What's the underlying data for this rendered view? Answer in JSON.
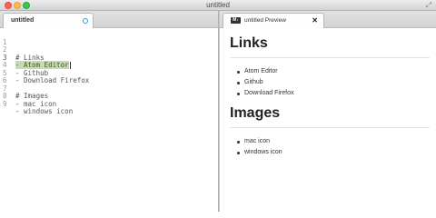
{
  "window": {
    "title": "untitled"
  },
  "editor": {
    "tab_title": "untitled",
    "lines": [
      {
        "num": "1",
        "text": ""
      },
      {
        "num": "2",
        "text": "# Links"
      },
      {
        "num": "3",
        "text": "- Atom Editor"
      },
      {
        "num": "4",
        "text": "- Github"
      },
      {
        "num": "5",
        "text": "- Download Firefox"
      },
      {
        "num": "6",
        "text": ""
      },
      {
        "num": "7",
        "text": "# Images"
      },
      {
        "num": "8",
        "text": "- mac icon"
      },
      {
        "num": "9",
        "text": "- windows icon"
      }
    ]
  },
  "preview": {
    "tab_title": "untitled Preview",
    "tab_icon_label": "M↓",
    "sections": [
      {
        "heading": "Links",
        "items": [
          "Atom Editor",
          "Github",
          "Download Firefox"
        ]
      },
      {
        "heading": "Images",
        "items": [
          "mac icon",
          "windows icon"
        ]
      }
    ]
  },
  "colors": {
    "selection_highlight": "#c8dab4",
    "modified_indicator": "#2a9fd6"
  }
}
